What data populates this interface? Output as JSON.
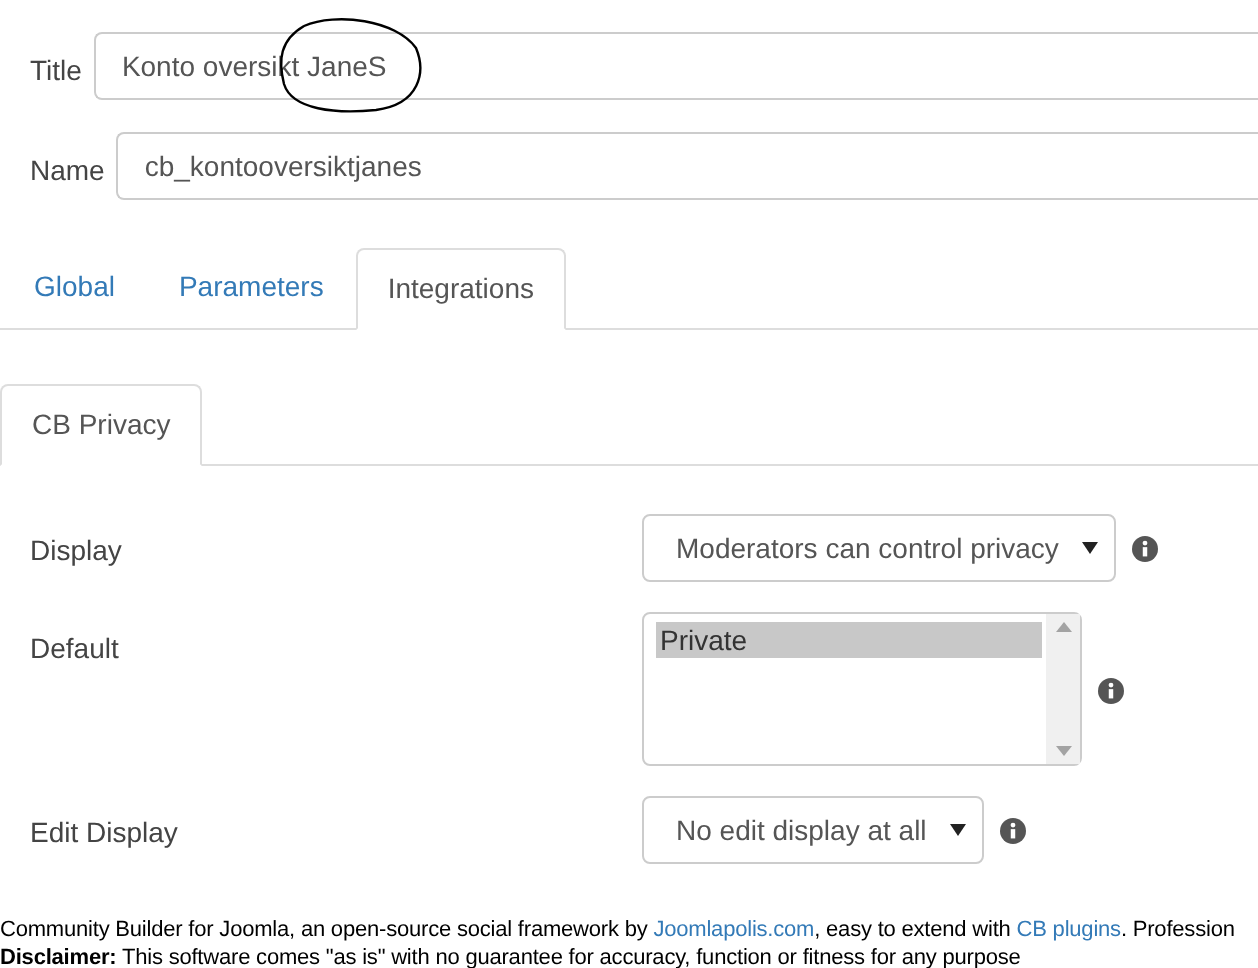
{
  "fields": [
    {
      "label": "Title",
      "value": "Konto oversikt JaneS",
      "annotated": true
    },
    {
      "label": "Name",
      "value": "cb_kontooversiktjanes",
      "annotated": false
    }
  ],
  "tabs": [
    {
      "label": "Global",
      "selected": false
    },
    {
      "label": "Parameters",
      "selected": false
    },
    {
      "label": "Integrations",
      "selected": true
    }
  ],
  "subtabs": [
    {
      "label": "CB Privacy",
      "selected": true
    }
  ],
  "settings": [
    {
      "kind": "select",
      "label": "Display",
      "value": "Moderators can control privacy"
    },
    {
      "kind": "listbox",
      "label": "Default",
      "options": [
        {
          "label": "Private",
          "selected": true
        }
      ]
    },
    {
      "kind": "select",
      "label": "Edit Display",
      "value": "No edit display at all"
    }
  ],
  "footer": {
    "parts": [
      {
        "kind": "text",
        "text": "Community Builder for Joomla, an open-source social framework by "
      },
      {
        "kind": "link",
        "text": "Joomlapolis.com"
      },
      {
        "kind": "text",
        "text": ", easy to extend with "
      },
      {
        "kind": "link",
        "text": "CB plugins"
      },
      {
        "kind": "text",
        "text": ". Profession"
      }
    ],
    "disclaimer": "**Disclaimer:** This software comes \"as is\" with no guarantee for accuracy, function or fitness for any purpose"
  }
}
